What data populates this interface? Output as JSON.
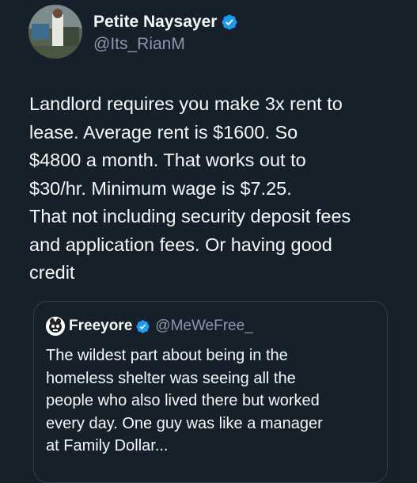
{
  "author": {
    "display_name": "Petite Naysayer",
    "handle": "@Its_RianM",
    "verified": true
  },
  "tweet": {
    "text": "Landlord requires you make 3x rent to\nlease. Average rent is $1600. So\n$4800 a month. That works out to\n$30/hr. Minimum wage is $7.25.\nThat not including security deposit fees\nand application fees. Or having good\ncredit"
  },
  "quoted_tweet": {
    "display_name": "Freeyore",
    "handle": "@MeWeFree_",
    "verified": true,
    "text": "The wildest part about being in the\nhomeless shelter was seeing all the\npeople who also lived there but worked\nevery day. One guy was like a manager\nat Family Dollar..."
  },
  "colors": {
    "background": "#15202b",
    "text": "#f7f9f9",
    "secondary_text": "#8b98a5",
    "verified_blue": "#1d9bf0"
  },
  "icons": {
    "verified": "verified-badge-icon",
    "quote_avatar": "freeyore-avatar-icon"
  }
}
